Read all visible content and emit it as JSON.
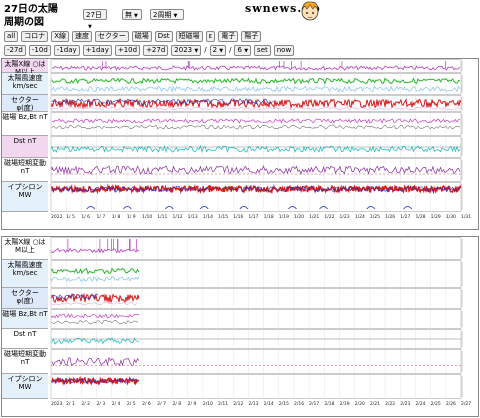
{
  "page_title": "27日の太陽周期の図",
  "logo_text": "swnews. jp",
  "selects": [
    {
      "name": "days-select",
      "value": "27日"
    },
    {
      "name": "mode-select",
      "value": "無"
    },
    {
      "name": "cycle-select",
      "value": "2周期"
    }
  ],
  "toggles": [
    "all",
    "コロナ",
    "X線",
    "速度",
    "セクター",
    "磁場",
    "Dst",
    "短磁場",
    "ε",
    "電子",
    "陽子"
  ],
  "nav": {
    "back": [
      "-27d",
      "-10d",
      "-1day"
    ],
    "fwd": [
      "+1day",
      "+10d",
      "+27d"
    ],
    "year": "2023",
    "month": "2",
    "day": "6",
    "set": "set",
    "now": "now"
  },
  "panels": [
    {
      "id": "panel1",
      "dates": [
        "2022",
        "1/ 5",
        "1/ 6",
        "1/ 7",
        "1/ 8",
        "1/ 9",
        "1/10",
        "1/11",
        "1/12",
        "1/13",
        "1/14",
        "1/15",
        "1/16",
        "1/17",
        "1/18",
        "1/19",
        "1/20",
        "1/21",
        "1/22",
        "1/23",
        "1/24",
        "1/25",
        "1/26",
        "1/27",
        "1/28",
        "1/29",
        "1/30",
        "1/31"
      ],
      "rows": [
        {
          "label": "太陽X線 ○はM以上",
          "bg": "#f1d8ee"
        },
        {
          "label": "太陽風速度 km/sec",
          "bg": "#e4f0fa"
        },
        {
          "label": "セクター φ(度)",
          "bg": "#dde9f8"
        },
        {
          "label": "磁場 Bz,Bt nT",
          "bg": "#ffffff"
        },
        {
          "label": "Dst nT",
          "bg": "#f1d8ee"
        },
        {
          "label": "磁場短期変動 nT",
          "bg": "#ffffff"
        },
        {
          "label": "イプシロン MW",
          "bg": "#e4f0fa"
        }
      ]
    },
    {
      "id": "panel2",
      "dates": [
        "2023",
        "2/ 1",
        "2/ 2",
        "2/ 3",
        "2/ 4",
        "2/ 5",
        "2/ 6",
        "2/ 7",
        "2/ 8",
        "2/ 9",
        "2/10",
        "2/11",
        "2/12",
        "2/13",
        "2/14",
        "2/15",
        "2/16",
        "2/17",
        "2/18",
        "2/19",
        "2/20",
        "2/21",
        "2/22",
        "2/23",
        "2/24",
        "2/25",
        "2/26",
        "2/27"
      ],
      "rows": [
        {
          "label": "太陽X線 ○はM以上",
          "bg": "#ffffff"
        },
        {
          "label": "太陽風速度 km/sec",
          "bg": "#e4f0fa"
        },
        {
          "label": "セクター φ(度)",
          "bg": "#dde9f8"
        },
        {
          "label": "磁場 Bz,Bt nT",
          "bg": "#e4f0fa"
        },
        {
          "label": "Dst nT",
          "bg": "#ffffff"
        },
        {
          "label": "磁場短期変動 nT",
          "bg": "#ffffff"
        },
        {
          "label": "イプシロン MW",
          "bg": "#e4f0fa"
        }
      ]
    }
  ]
}
